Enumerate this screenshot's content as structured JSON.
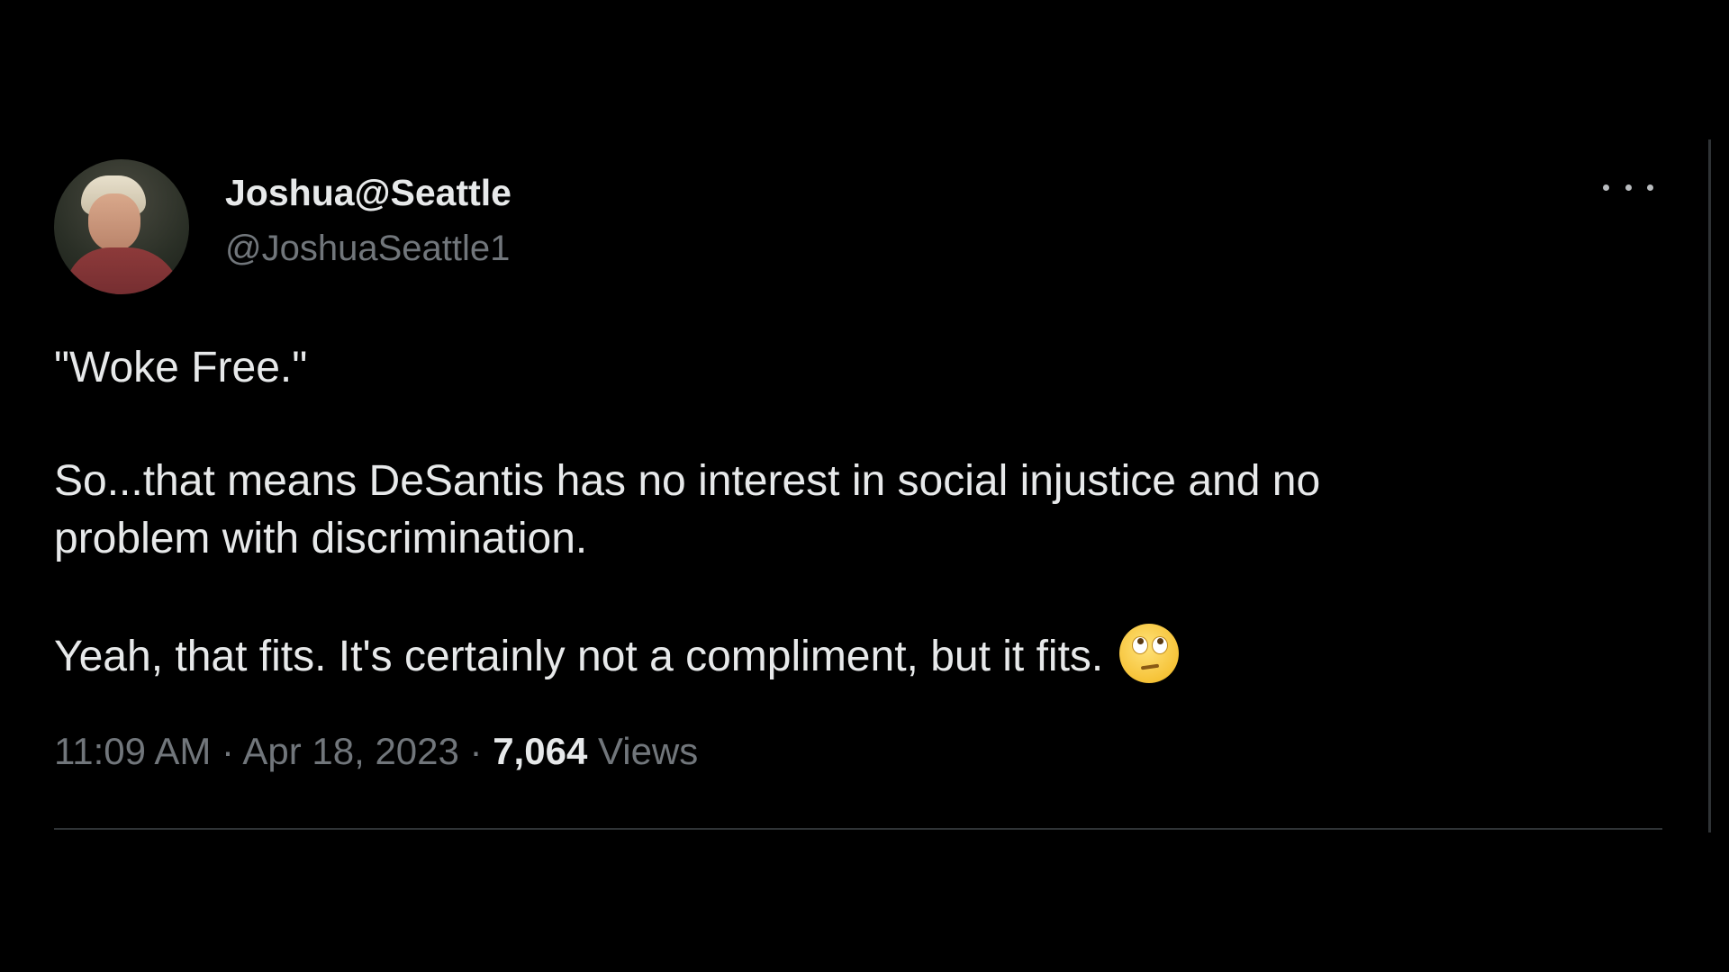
{
  "author": {
    "display_name": "Joshua@Seattle",
    "handle": "@JoshuaSeattle1"
  },
  "tweet": {
    "lines": [
      "\"Woke Free.\"",
      "So...that means DeSantis has no interest in social injustice and no",
      "problem with discrimination.",
      "Yeah, that fits.  It's certainly not a compliment, but it fits."
    ],
    "emoji_icon": "face-with-rolling-eyes-icon"
  },
  "meta": {
    "time": "11:09 AM",
    "separator": " · ",
    "date": "Apr 18, 2023",
    "views_count": "7,064",
    "views_label": "Views"
  },
  "colors": {
    "background": "#000000",
    "primary_text": "#e7e9ea",
    "secondary_text": "#71767b",
    "divider": "#2f3336"
  }
}
